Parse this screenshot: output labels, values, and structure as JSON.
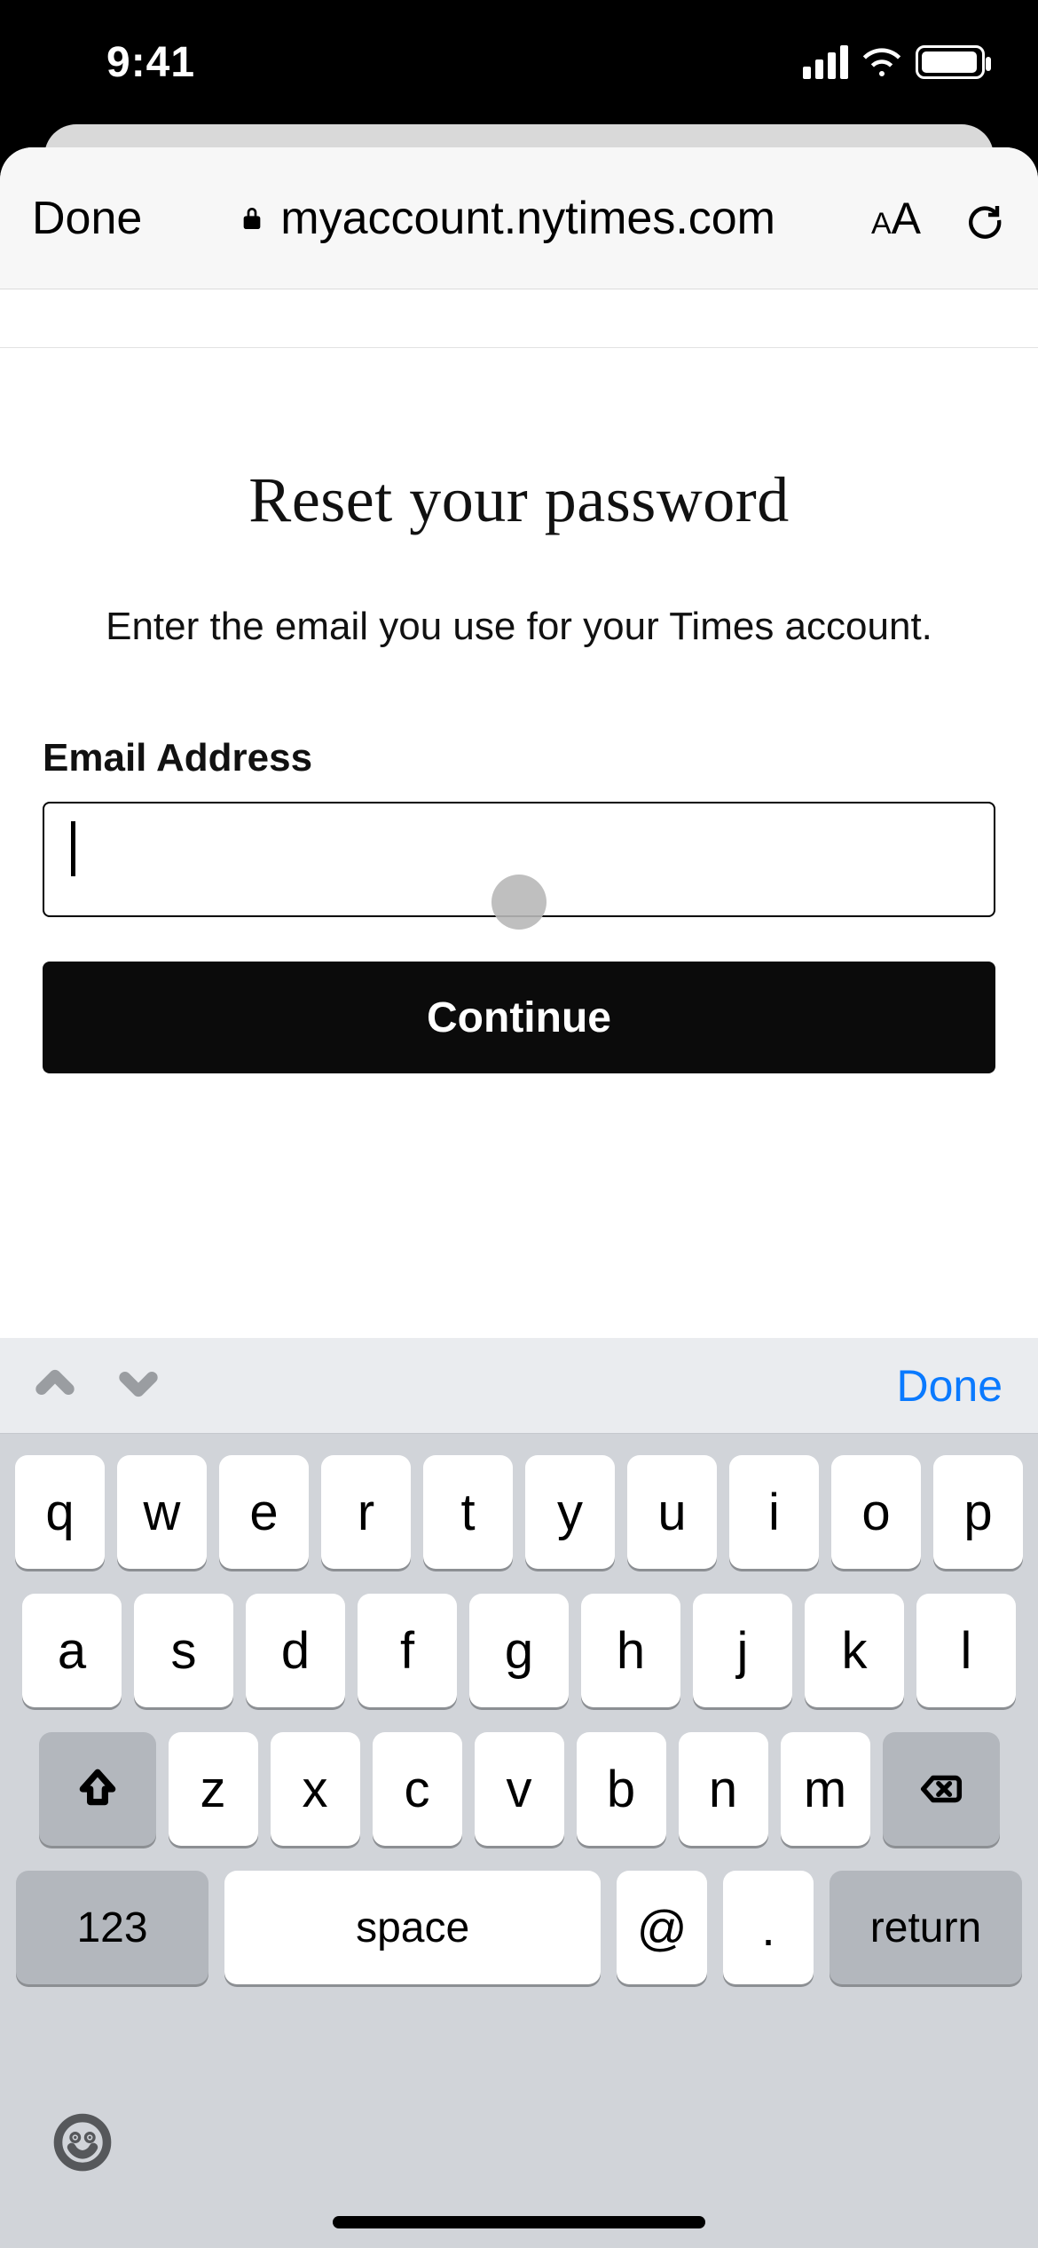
{
  "statusbar": {
    "time": "9:41"
  },
  "toolbar": {
    "done_label": "Done",
    "url": "myaccount.nytimes.com",
    "aa_small": "A",
    "aa_big": "A"
  },
  "page": {
    "title": "Reset your password",
    "subtitle": "Enter the email you use for your Times account.",
    "email_label": "Email Address",
    "email_value": "",
    "continue_label": "Continue"
  },
  "keyboard": {
    "toolbar_done": "Done",
    "row1": [
      "q",
      "w",
      "e",
      "r",
      "t",
      "y",
      "u",
      "i",
      "o",
      "p"
    ],
    "row2": [
      "a",
      "s",
      "d",
      "f",
      "g",
      "h",
      "j",
      "k",
      "l"
    ],
    "row3": [
      "z",
      "x",
      "c",
      "v",
      "b",
      "n",
      "m"
    ],
    "k123": "123",
    "space": "space",
    "at": "@",
    "dot": ".",
    "ret": "return"
  }
}
